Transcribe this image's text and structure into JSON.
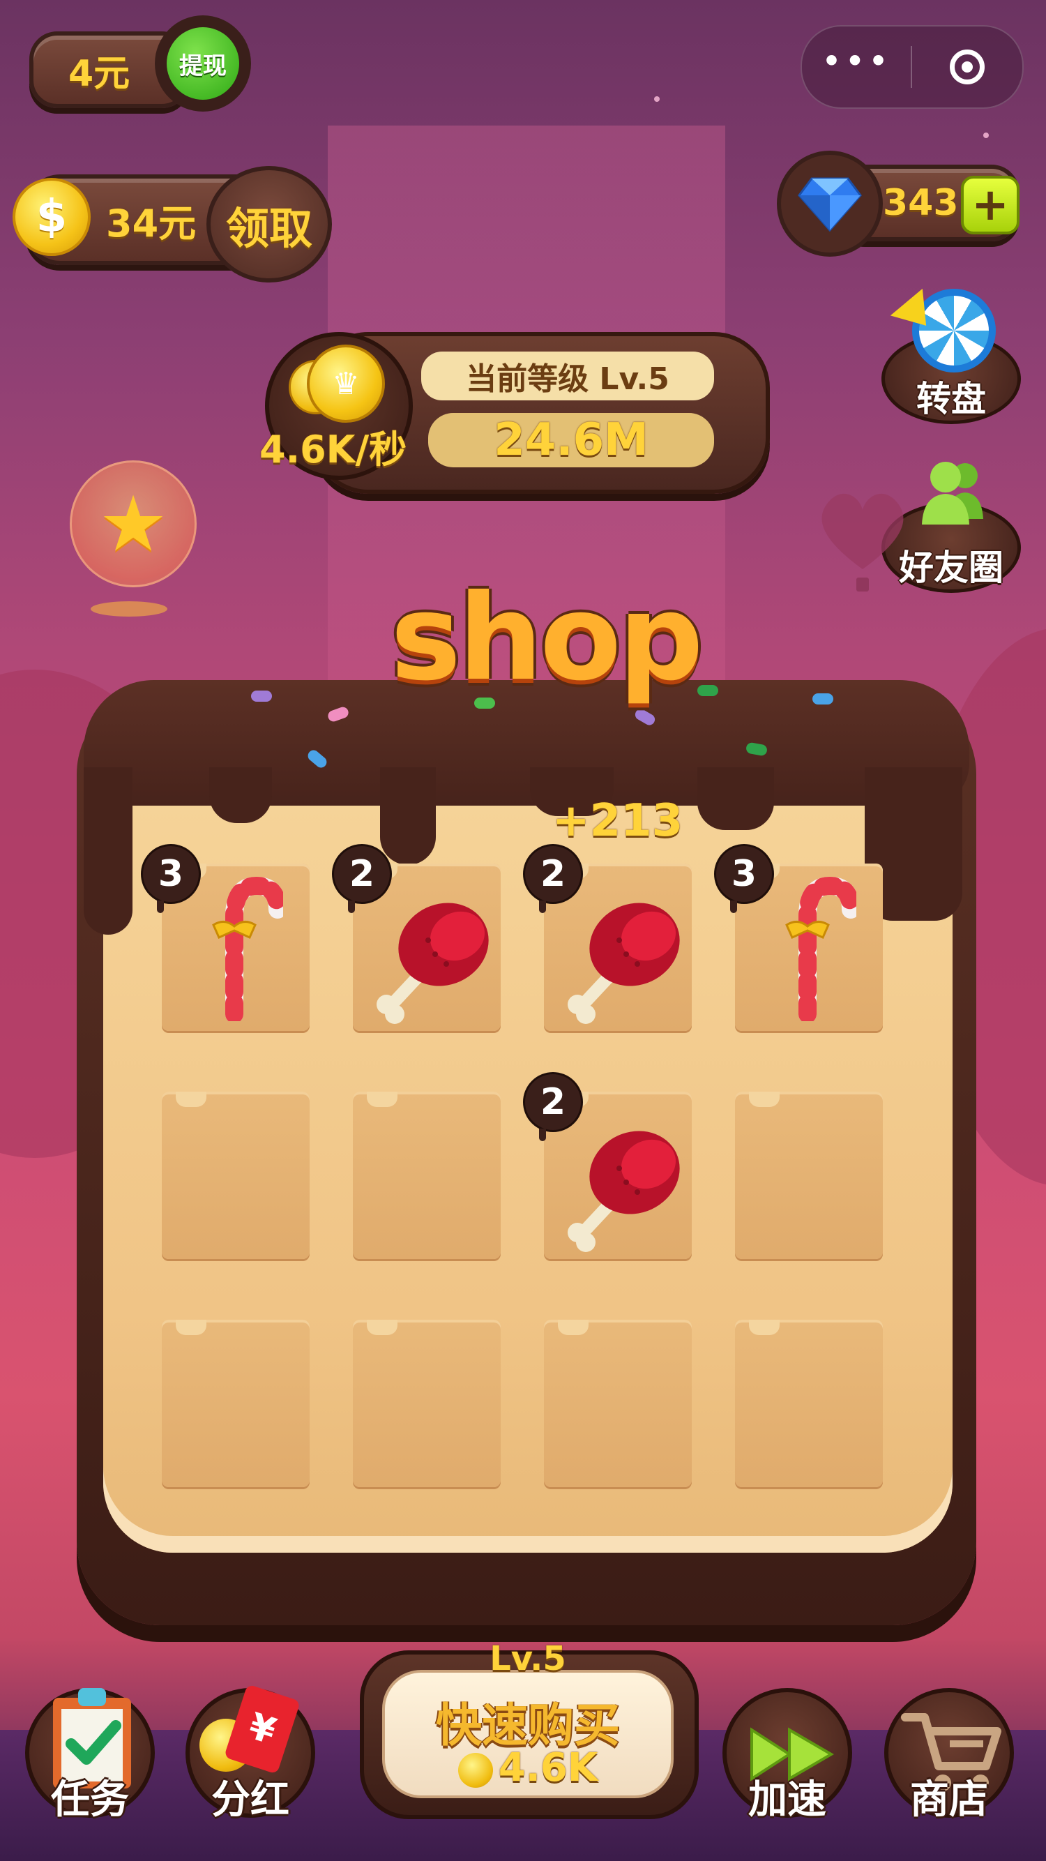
{
  "top_left": {
    "cash": "4元",
    "withdraw_label": "提现",
    "coin_amount": "34元",
    "claim_label": "领取",
    "coin_symbol": "$"
  },
  "capsule": {
    "more_icon": "more-dots-icon",
    "close_icon": "target-icon"
  },
  "gems": {
    "count": "343",
    "plus_symbol": "+"
  },
  "level": {
    "title": "当前等级 Lv.5",
    "total": "24.6M",
    "rate": "4.6K/秒"
  },
  "side": {
    "wheel_label": "转盘",
    "friends_label": "好友圈"
  },
  "shop": {
    "title": "shop",
    "gain": "+213",
    "grid": [
      {
        "row": 0,
        "col": 0,
        "item": "candy-cane",
        "level": "3"
      },
      {
        "row": 0,
        "col": 1,
        "item": "meat",
        "level": "2"
      },
      {
        "row": 0,
        "col": 2,
        "item": "meat",
        "level": "2"
      },
      {
        "row": 0,
        "col": 3,
        "item": "candy-cane",
        "level": "3"
      },
      {
        "row": 1,
        "col": 0,
        "item": null,
        "level": null
      },
      {
        "row": 1,
        "col": 1,
        "item": null,
        "level": null
      },
      {
        "row": 1,
        "col": 2,
        "item": "meat",
        "level": "2"
      },
      {
        "row": 1,
        "col": 3,
        "item": null,
        "level": null
      },
      {
        "row": 2,
        "col": 0,
        "item": null,
        "level": null
      },
      {
        "row": 2,
        "col": 1,
        "item": null,
        "level": null
      },
      {
        "row": 2,
        "col": 2,
        "item": null,
        "level": null
      },
      {
        "row": 2,
        "col": 3,
        "item": null,
        "level": null
      }
    ]
  },
  "bottom": {
    "tasks_label": "任务",
    "dividend_label": "分红",
    "buy_level": "Lv.5",
    "buy_label": "快速购买",
    "buy_cost": "4.6K",
    "speed_label": "加速",
    "store_label": "商店",
    "red_packet_symbol": "¥"
  },
  "colors": {
    "accent_gold": "#ffd33a",
    "chocolate": "#4e2a22",
    "board": "#f0c486",
    "green": "#2ea915"
  }
}
